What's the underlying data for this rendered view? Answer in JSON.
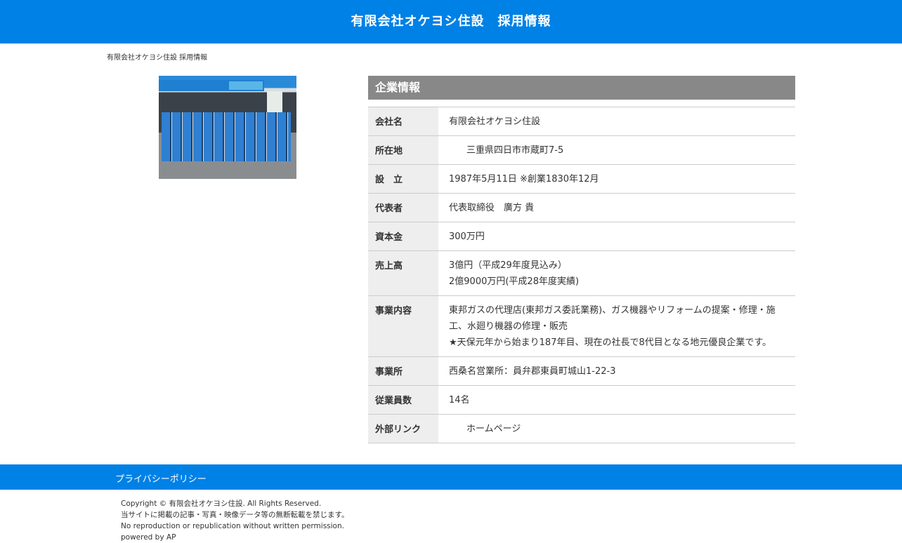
{
  "header": {
    "title": "有限会社オケヨシ住設　採用情報"
  },
  "breadcrumb": "有限会社オケヨシ住設 採用情報",
  "section": {
    "title": "企業情報"
  },
  "rows": [
    {
      "label": "会社名",
      "value": "有限会社オケヨシ住設"
    },
    {
      "label": "所在地",
      "value": "三重県四日市市蔵町7-5"
    },
    {
      "label": "設　立",
      "value": "1987年5月11日 ※創業1830年12月"
    },
    {
      "label": "代表者",
      "value": "代表取締役　廣方 貴"
    },
    {
      "label": "資本金",
      "value": "300万円"
    },
    {
      "label": "売上高",
      "lines": [
        "3億円（平成29年度見込み）",
        "2億9000万円(平成28年度実績)"
      ]
    },
    {
      "label": "事業内容",
      "lines": [
        "東邦ガスの代理店(東邦ガス委託業務)、ガス機器やリフォームの提案・修理・施工、水廻り機器の修理・販売",
        "★天保元年から始まり187年目、現在の社長で8代目となる地元優良企業です。"
      ]
    },
    {
      "label": "事業所",
      "value": "西桑名営業所：員弁郡東員町城山1-22-3"
    },
    {
      "label": "従業員数",
      "value": "14名"
    },
    {
      "label": "外部リンク",
      "value": "ホームページ"
    }
  ],
  "footer": {
    "privacy": "プライバシーポリシー",
    "copyright": "Copyright © 有限会社オケヨシ住設. All Rights Reserved.",
    "notice_ja": "当サイトに掲載の記事・写真・映像データ等の無断転載を禁じます。",
    "notice_en": "No reproduction or republication without written permission.",
    "powered": "powered by AP"
  }
}
